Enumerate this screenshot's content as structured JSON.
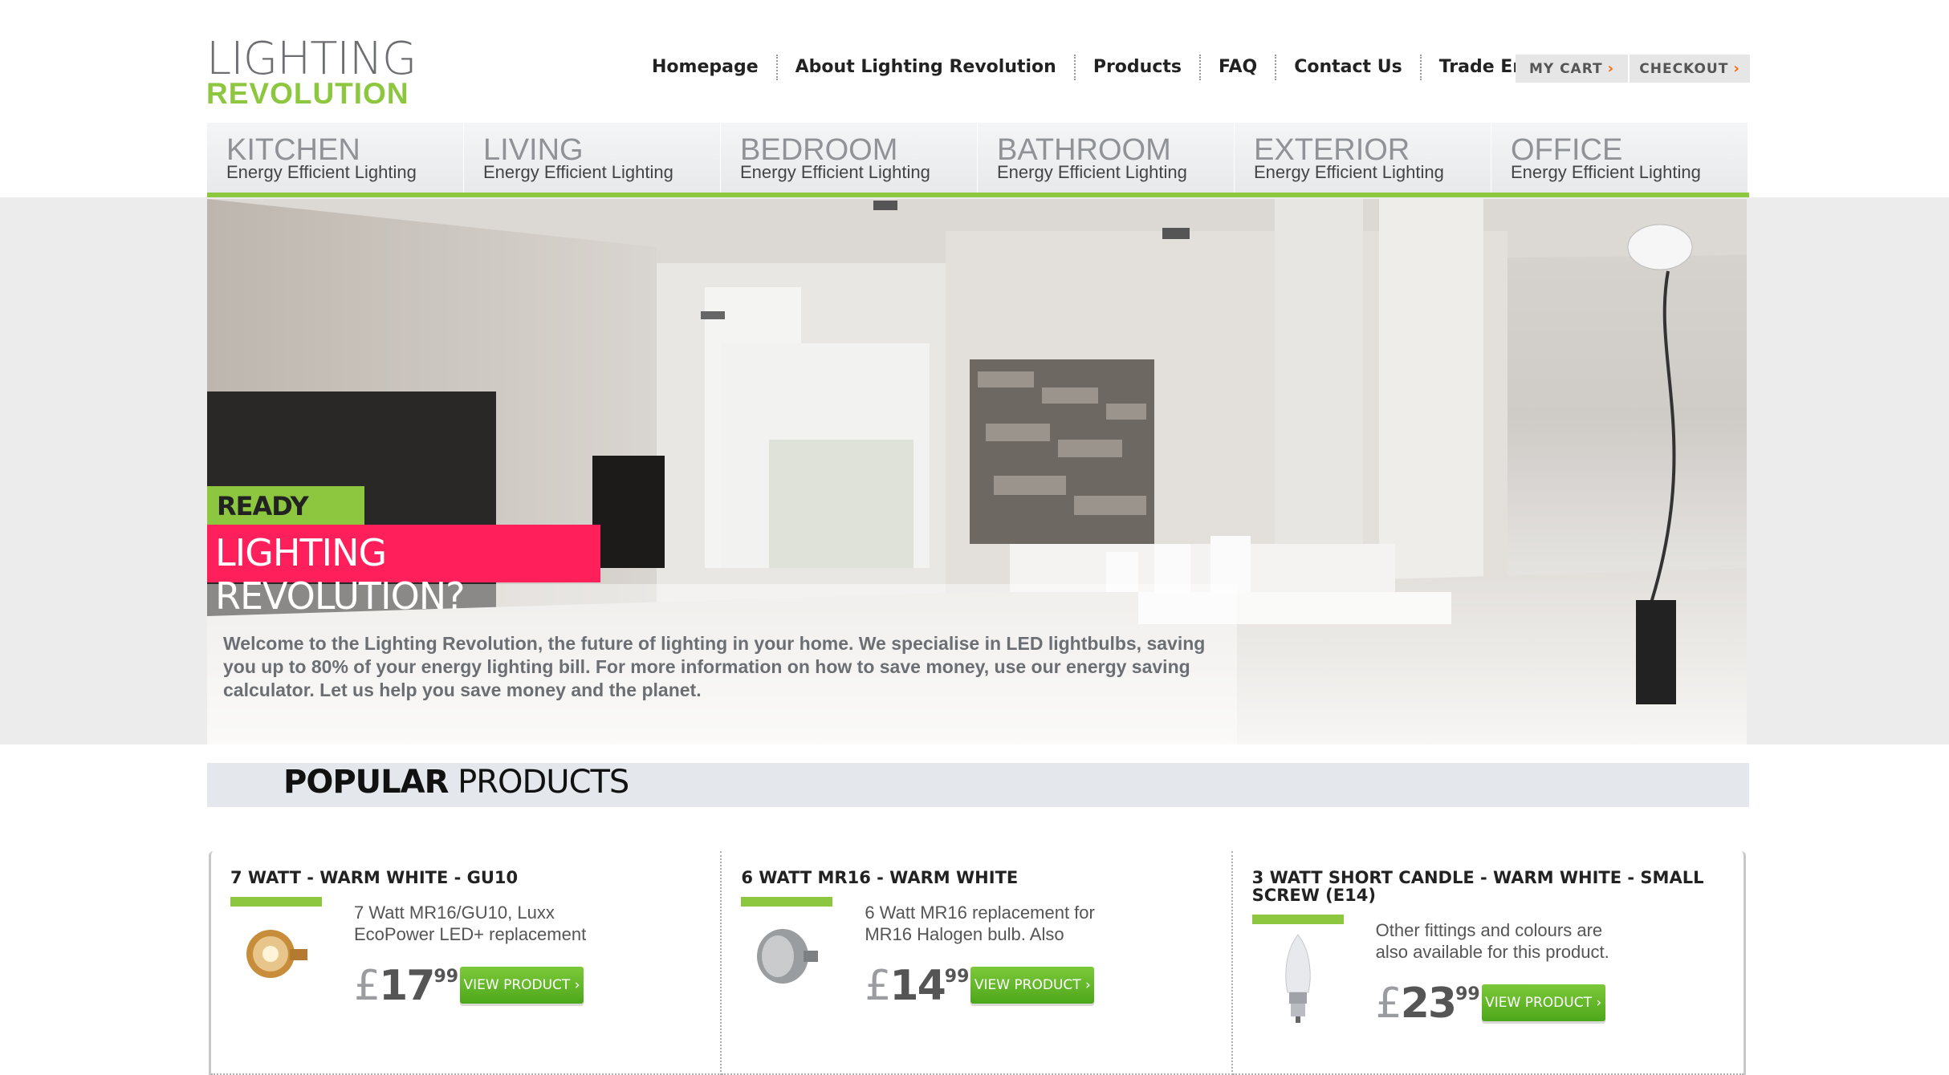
{
  "logo": {
    "line1": "LIGHTING",
    "line2": "REVOLUTION"
  },
  "topnav": [
    "Homepage",
    "About Lighting Revolution",
    "Products",
    "FAQ",
    "Contact Us",
    "Trade Enquiries"
  ],
  "cart": {
    "mycart": "MY CART",
    "checkout": "CHECKOUT",
    "arrow": "›"
  },
  "categories": [
    {
      "name": "KITCHEN",
      "sub": "Energy Efficient Lighting"
    },
    {
      "name": "LIVING",
      "sub": "Energy Efficient Lighting"
    },
    {
      "name": "BEDROOM",
      "sub": "Energy Efficient Lighting"
    },
    {
      "name": "BATHROOM",
      "sub": "Energy Efficient Lighting"
    },
    {
      "name": "EXTERIOR",
      "sub": "Energy Efficient Lighting"
    },
    {
      "name": "OFFICE",
      "sub": "Energy Efficient Lighting"
    }
  ],
  "hero": {
    "ready": "READY FOR",
    "question": "LIGHTING REVOLUTION?",
    "welcome": "Welcome to the Lighting Revolution, the future of lighting in your home. We specialise in LED lightbulbs, saving you up to 80% of your energy lighting bill. For more information on how to save money, use our energy saving calculator. Let us help you save money and the planet."
  },
  "popular": {
    "bold": "POPULAR",
    "rest": " PRODUCTS"
  },
  "products": [
    {
      "title": "7 WATT - WARM WHITE - GU10",
      "desc": "7 Watt MR16/GU10, Luxx EcoPower LED+ replacement",
      "currency": "£",
      "price": "17",
      "pence": "99",
      "button": "VIEW PRODUCT ›"
    },
    {
      "title": "6 WATT MR16 - WARM WHITE",
      "desc": "6 Watt MR16 replacement for MR16 Halogen bulb. Also",
      "currency": "£",
      "price": "14",
      "pence": "99",
      "button": "VIEW PRODUCT ›"
    },
    {
      "title": "3 WATT SHORT CANDLE - WARM WHITE - SMALL SCREW (E14)",
      "desc": "Other fittings and colours are also available for this product.",
      "currency": "£",
      "price": "23",
      "pence": "99",
      "button": "VIEW PRODUCT ›"
    }
  ],
  "colors": {
    "accent_green": "#8dc63f",
    "accent_pink": "#ff1f5a",
    "cart_arrow": "#ff6600"
  }
}
